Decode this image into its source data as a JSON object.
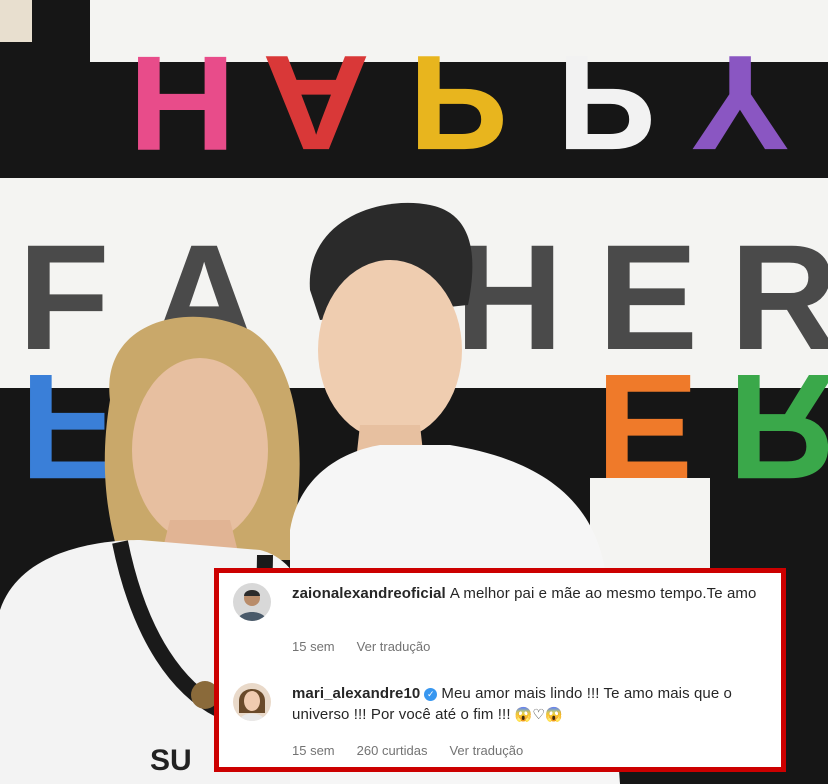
{
  "photo": {
    "banner_top_word": "HAPPY",
    "banner_mid_word": "FATHER",
    "letter_colors": {
      "pink": "#e84c8a",
      "red": "#d93838",
      "yellow": "#e8b51e",
      "purple": "#8a56c2",
      "blue": "#3a7fd8",
      "orange": "#ef7a2a",
      "green": "#3aa84a",
      "gray": "#4a4a4a"
    },
    "shirt_text": "SU"
  },
  "comments": [
    {
      "username": "zaionalexandreoficial",
      "verified": false,
      "text": "A melhor pai e mãe ao mesmo tempo.Te amo",
      "time": "15 sem",
      "likes": "",
      "translate": "Ver tradução"
    },
    {
      "username": "mari_alexandre10",
      "verified": true,
      "text": "Meu amor mais lindo !!! Te amo mais que o universo !!! Por você até o fim !!!",
      "emojis": "😱♡😱",
      "time": "15 sem",
      "likes": "260 curtidas",
      "translate": "Ver tradução"
    }
  ],
  "colors": {
    "highlight_border": "#cc0000",
    "verified_badge": "#3897f0"
  }
}
